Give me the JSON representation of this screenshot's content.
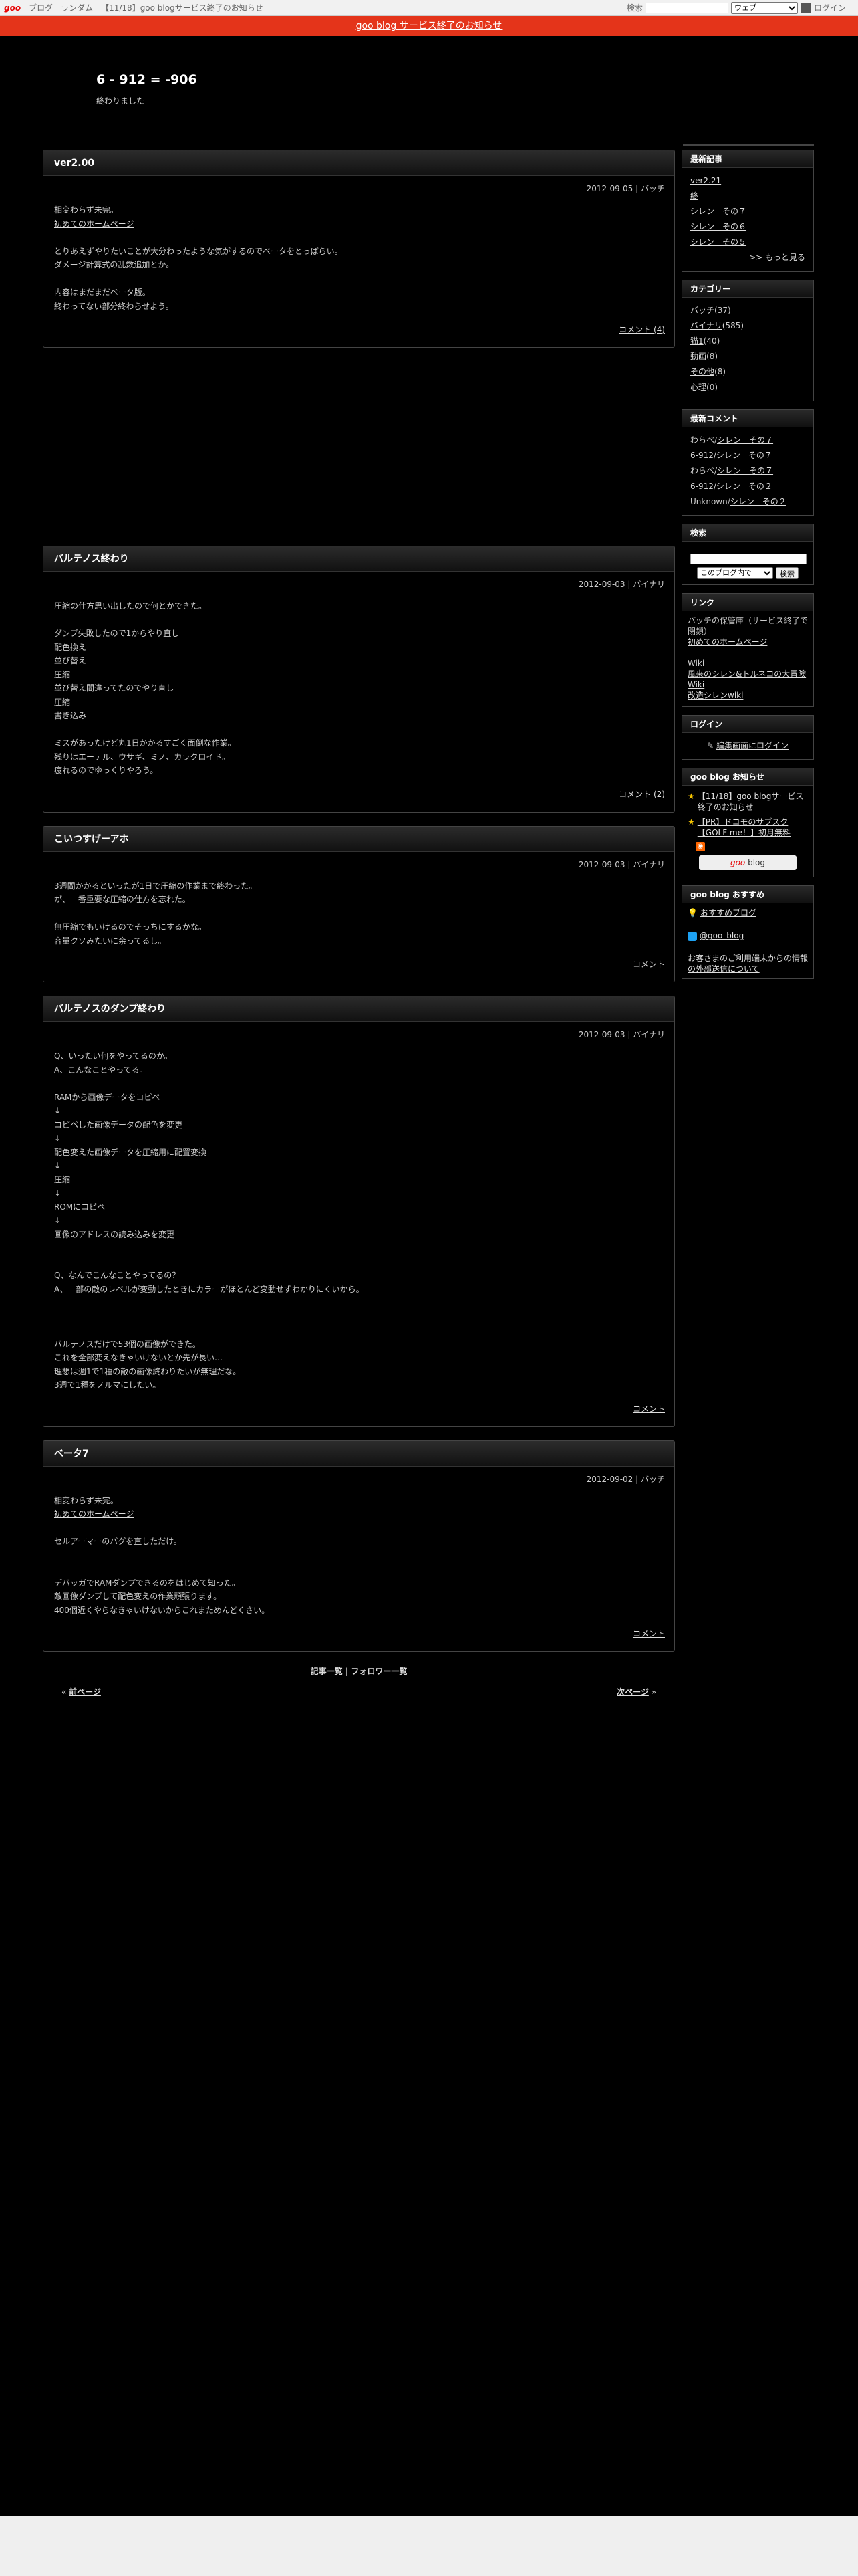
{
  "toolbar": {
    "logo": "goo",
    "links": [
      "ブログ",
      "ランダム",
      "【11/18】goo blogサービス終了のお知らせ"
    ],
    "search_label": "検索",
    "search_select": "ウェブ",
    "login": "ログイン"
  },
  "notice": "goo blog サービス終了のお知らせ",
  "blog": {
    "title": "6 - 912 = -906",
    "description": "終わりました"
  },
  "posts": [
    {
      "title": "ver2.00",
      "meta": "2012-09-05 | バッチ",
      "lines": [
        "相変わらず未完。",
        "初めてのホームページ",
        "",
        "とりあえずやりたいことが大分わったような気がするのでベータをとっぱらい。",
        "ダメージ計算式の乱数追加とか。",
        "",
        "内容はまだまだベータ版。",
        "終わってない部分終わらせよう。"
      ],
      "link_line": 1,
      "footer": "コメント (4)"
    },
    {
      "title": "バルテノス終わり",
      "meta": "2012-09-03 | バイナリ",
      "lines": [
        "圧縮の仕方思い出したので何とかできた。",
        "",
        "ダンプ失敗したので1からやり直し",
        "配色換え",
        "並び替え",
        "圧縮",
        "並び替え間違ってたのでやり直し",
        "圧縮",
        "書き込み",
        "",
        "ミスがあったけど丸1日かかるすごく面倒な作業。",
        "残りはエーテル、ウサギ、ミノ、カラクロイド。",
        "疲れるのでゆっくりやろう。"
      ],
      "link_line": -1,
      "footer": "コメント (2)"
    },
    {
      "title": "こいつすげーアホ",
      "meta": "2012-09-03 | バイナリ",
      "lines": [
        "3週間かかるといったが1日で圧縮の作業まで終わった。",
        "が、一番重要な圧縮の仕方を忘れた。",
        "",
        "無圧縮でもいけるのでそっちにするかな。",
        "容量クソみたいに余ってるし。"
      ],
      "link_line": -1,
      "footer": "コメント"
    },
    {
      "title": "バルテノスのダンプ終わり",
      "meta": "2012-09-03 | バイナリ",
      "lines": [
        "Q、いったい何をやってるのか。",
        "A、こんなことやってる。",
        "",
        "RAMから画像データをコピペ",
        "↓",
        "コピペした画像データの配色を変更",
        "↓",
        "配色変えた画像データを圧縮用に配置変換",
        "↓",
        "圧縮",
        "↓",
        "ROMにコピペ",
        "↓",
        "画像のアドレスの読み込みを変更",
        "",
        "",
        "Q、なんでこんなことやってるの？",
        "A、一部の敵のレベルが変動したときにカラーがほとんど変動せずわかりにくいから。",
        "",
        "",
        "",
        "バルテノスだけで53個の画像ができた。",
        "これを全部変えなきゃいけないとか先が長い…",
        "理想は週1で1種の敵の画像終わりたいが無理だな。",
        "3週で1種をノルマにしたい。"
      ],
      "link_line": -1,
      "footer": "コメント"
    },
    {
      "title": "ベータ7",
      "meta": "2012-09-02 | バッチ",
      "lines": [
        "相変わらず未完。",
        "初めてのホームページ",
        "",
        "セルアーマーのバグを直しただけ。",
        "",
        "",
        "デバッガでRAMダンプできるのをはじめて知った。",
        "敵画像ダンプして配色変えの作業頑張ります。",
        "400個近くやらなきゃいけないからこれまためんどくさい。"
      ],
      "link_line": 1,
      "footer": "コメント"
    }
  ],
  "pager": {
    "center_left": "記事一覧",
    "center_right": "フォロワー一覧",
    "prev": "前ページ",
    "next": "次ページ"
  },
  "sidebar": {
    "recent": {
      "title": "最新記事",
      "items": [
        "ver2.21",
        "終",
        "シレン　その７",
        "シレン　その６",
        "シレン　その５"
      ],
      "more": ">> もっと見る"
    },
    "categories": {
      "title": "カテゴリー",
      "items": [
        {
          "name": "バッチ",
          "count": "(37)"
        },
        {
          "name": "バイナリ",
          "count": "(585)"
        },
        {
          "name": "猫1",
          "count": "(40)"
        },
        {
          "name": "動画",
          "count": "(8)"
        },
        {
          "name": "その他",
          "count": "(8)"
        },
        {
          "name": "心理",
          "count": "(0)"
        }
      ]
    },
    "comments": {
      "title": "最新コメント",
      "items": [
        {
          "who": "わらべ/",
          "post": "シレン　その７"
        },
        {
          "who": "6-912/",
          "post": "シレン　その７"
        },
        {
          "who": "わらべ/",
          "post": "シレン　その７"
        },
        {
          "who": "6-912/",
          "post": "シレン　その２"
        },
        {
          "who": "Unknown/",
          "post": "シレン　その２"
        }
      ]
    },
    "search": {
      "title": "検索",
      "scope": "このブログ内で",
      "button": "検索"
    },
    "links": {
      "title": "リンク",
      "text1": "バッチの保管庫（サービス終了で閉鎖）",
      "link1": "初めてのホームページ",
      "label2": "Wiki",
      "link2": "風来のシレン&トルネコの大冒険 Wiki",
      "link3": "改造シレンwiki"
    },
    "login": {
      "title": "ログイン",
      "link": "編集画面にログイン"
    },
    "goo_news": {
      "title": "goo blog お知らせ",
      "items": [
        "【11/18】goo blogサービス終了のお知らせ",
        "【PR】ドコモのサブスク【GOLF me！】初月無料"
      ],
      "btn_g": "goo",
      "btn_text": " blog"
    },
    "recommend": {
      "title": "goo blog おすすめ",
      "items": [
        "おすすめブログ",
        "@goo_blog",
        "お客さまのご利用端末からの情報の外部送信について"
      ]
    }
  }
}
